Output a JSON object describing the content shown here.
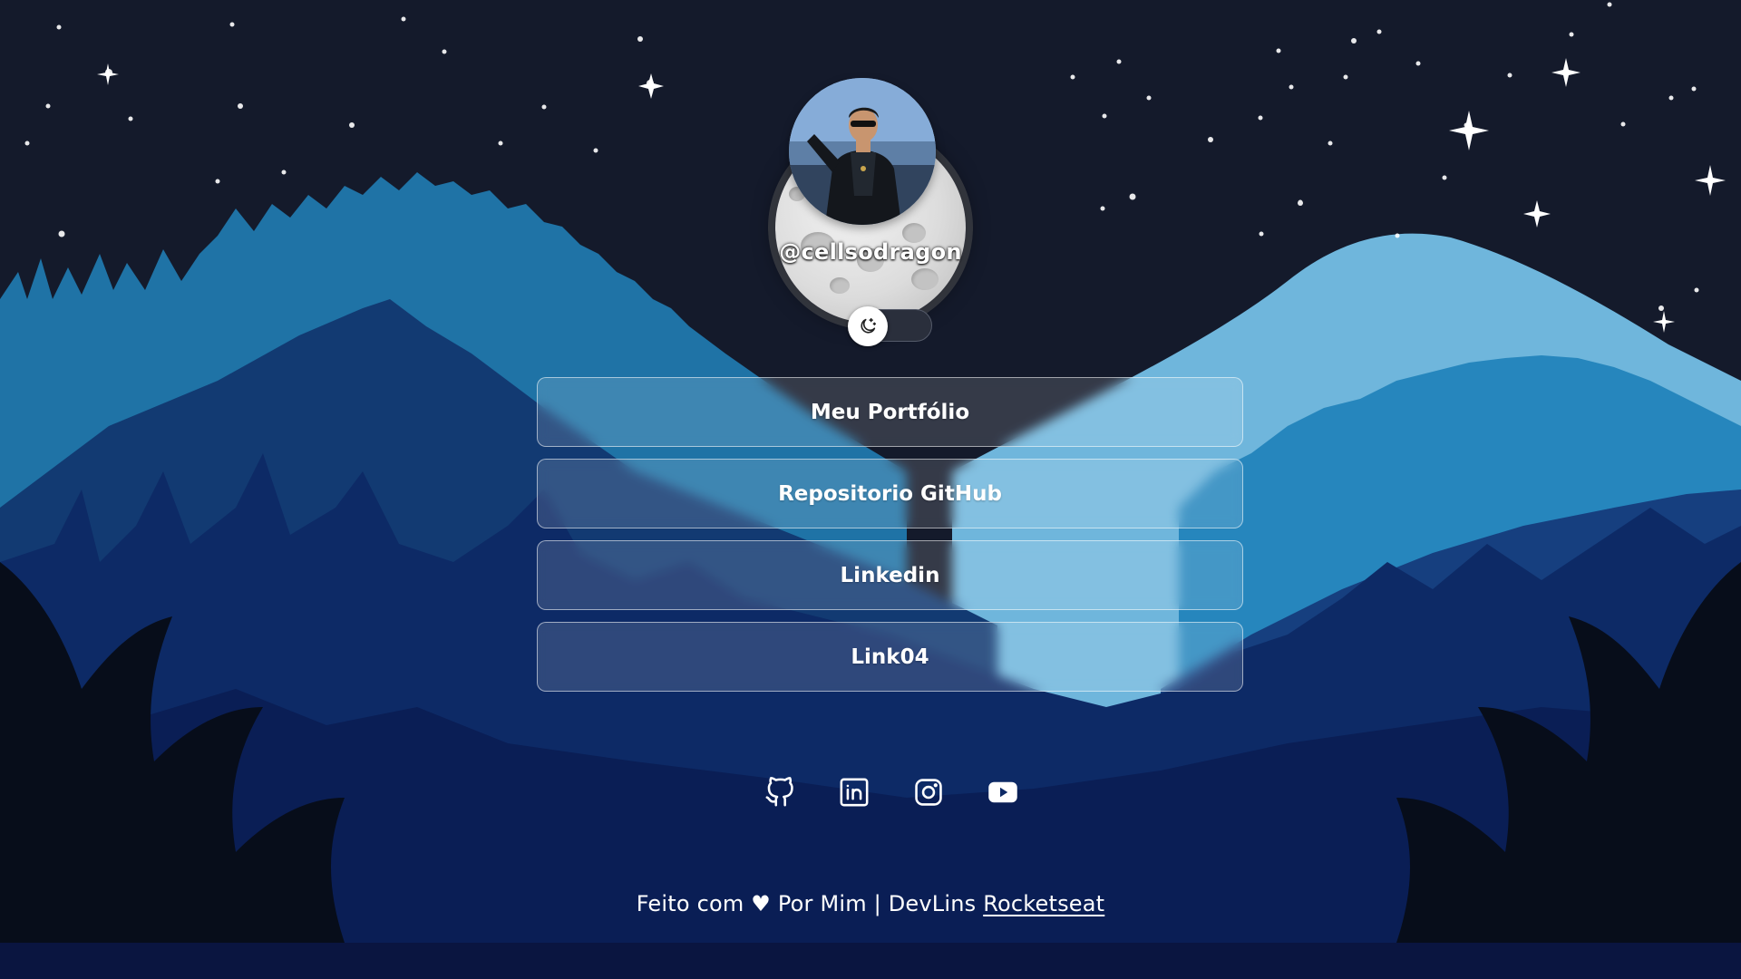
{
  "profile": {
    "username": "@cellsodragon"
  },
  "theme_toggle": {
    "icon": "moon-stars-icon",
    "state": "dark"
  },
  "links": [
    {
      "label": "Meu Portfólio"
    },
    {
      "label": "Repositorio GitHub"
    },
    {
      "label": "Linkedin"
    },
    {
      "label": "Link04"
    }
  ],
  "socials": [
    {
      "name": "github-icon"
    },
    {
      "name": "linkedin-icon"
    },
    {
      "name": "instagram-icon"
    },
    {
      "name": "youtube-icon"
    }
  ],
  "footer": {
    "text_before": "Feito com",
    "heart": "♥",
    "text_middle": "Por Mim | DevLins",
    "link": "Rocketseat"
  },
  "colors": {
    "sky": "#141a2b",
    "light_mountain": "#6fb6dc",
    "mid_blue": "#1f73a6",
    "dark_blue": "#123a72",
    "deep_blue": "#0a1e55"
  }
}
